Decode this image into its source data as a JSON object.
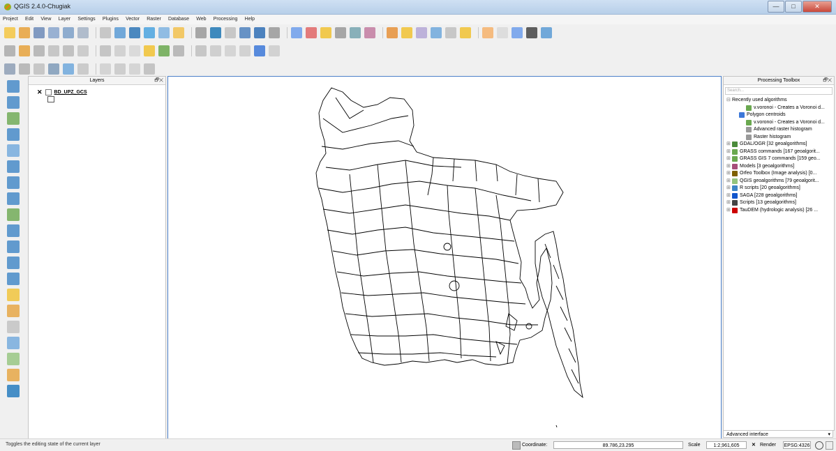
{
  "window": {
    "title": "QGIS 2.4.0-Chugiak",
    "controls": [
      "—",
      "□",
      "✕"
    ]
  },
  "menu": [
    "Project",
    "Edit",
    "View",
    "Layer",
    "Settings",
    "Plugins",
    "Vector",
    "Raster",
    "Database",
    "Web",
    "Processing",
    "Help"
  ],
  "layers_panel": {
    "title": "Layers",
    "controls": "🗗✕",
    "layer_name": "BD_UPZ_GCS"
  },
  "processing": {
    "title": "Processing Toolbox",
    "controls": "🗗✕",
    "search_placeholder": "Search...",
    "items": [
      {
        "label": "Recently used algorithms",
        "indent": 0,
        "pm": "⊟",
        "icon": "",
        "color": ""
      },
      {
        "label": "v.voronoi - Creates a Voronoi d...",
        "indent": 2,
        "pm": "",
        "icon": "grass-icon",
        "color": "#6aa84f"
      },
      {
        "label": "Polygon centroids",
        "indent": 1,
        "pm": "",
        "icon": "qgis-gear-icon",
        "color": "#3c78d8"
      },
      {
        "label": "v.voronoi - Creates a Voronoi d...",
        "indent": 2,
        "pm": "",
        "icon": "grass-icon",
        "color": "#6aa84f"
      },
      {
        "label": "Advanced raster histogram",
        "indent": 2,
        "pm": "",
        "icon": "gdal-icon",
        "color": "#999999"
      },
      {
        "label": "Raster histogram",
        "indent": 2,
        "pm": "",
        "icon": "gdal-icon",
        "color": "#999999"
      },
      {
        "label": "GDAL/OGR [32 geoalgorithms]",
        "indent": 0,
        "pm": "⊞",
        "icon": "gdal-icon",
        "color": "#4b8b3b"
      },
      {
        "label": "GRASS commands [167 geoalgorit...",
        "indent": 0,
        "pm": "⊞",
        "icon": "grass-icon",
        "color": "#6aa84f"
      },
      {
        "label": "GRASS GIS 7 commands [159 geo...",
        "indent": 0,
        "pm": "⊞",
        "icon": "grass-icon",
        "color": "#6aa84f"
      },
      {
        "label": "Models [3 geoalgorithms]",
        "indent": 0,
        "pm": "⊞",
        "icon": "model-icon",
        "color": "#a64d79"
      },
      {
        "label": "Orfeo Toolbox (Image analysis) [0...",
        "indent": 0,
        "pm": "⊞",
        "icon": "otb-icon",
        "color": "#7f6000"
      },
      {
        "label": "QGIS geoalgorithms [79 geoalgorit...",
        "indent": 0,
        "pm": "⊞",
        "icon": "qgis-icon",
        "color": "#93c47d"
      },
      {
        "label": "R scripts [20 geoalgorithms]",
        "indent": 0,
        "pm": "⊞",
        "icon": "r-icon",
        "color": "#3d85c6"
      },
      {
        "label": "SAGA [228 geoalgorithms]",
        "indent": 0,
        "pm": "⊞",
        "icon": "saga-icon",
        "color": "#1155cc"
      },
      {
        "label": "Scripts [13 geoalgorithms]",
        "indent": 0,
        "pm": "⊞",
        "icon": "script-icon",
        "color": "#444444"
      },
      {
        "label": "TauDEM (hydrologic analysis) [26 ...",
        "indent": 0,
        "pm": "⊞",
        "icon": "taudem-icon",
        "color": "#cc0000"
      }
    ],
    "advanced_interface": "Advanced interface"
  },
  "statusbar": {
    "message": "Toggles the editing state of the current layer",
    "coordinate_label": "Coordinate:",
    "coordinate_value": "89.786,23.295",
    "scale_label": "Scale",
    "scale_value": "1:2,961,605",
    "render_label": "Render",
    "crs": "EPSG:4326"
  },
  "toolbar_row1": [
    "#f4c542",
    "#e8a13a",
    "#6d8bb8",
    "#8aa6cc",
    "#7ca0c8",
    "#a4b3c6",
    "#c0c0c0",
    "#5a9bd5",
    "#2e75b6",
    "#4aa3df",
    "#7fb3e0",
    "#f2c14e",
    "#999999",
    "#1f77b4",
    "#c0c0c0",
    "#4f81bd",
    "#2f6fb5",
    "#999999",
    "#6d9eeb",
    "#e06666",
    "#f1c232",
    "#999999",
    "#76a5af",
    "#c27ba0",
    "#e69138",
    "#f1c232",
    "#b4a7d6",
    "#6fa8dc",
    "#c0c0c0",
    "#f1c232",
    "#f6b26b",
    "#d9d9d9",
    "#6d9eeb",
    "#444444",
    "#5b9bd5"
  ],
  "toolbar_row2": [
    "#aaaaaa",
    "#e6a23c",
    "#b0b0b0",
    "#c0c0c0",
    "#b8b8b8",
    "#c6c6c6",
    "#bdbdbd",
    "#cccccc",
    "#d6d6d6",
    "#f1c232",
    "#6aa84f",
    "#b0b0b0",
    "#c0c0c0",
    "#c9c9c9",
    "#d0d0d0",
    "#cccccc",
    "#3c78d8",
    "#cccccc"
  ],
  "toolbar_row3": [
    "#8e9fb5",
    "#b0b0b0",
    "#c0c0c0",
    "#7f9bb8",
    "#6fa8dc",
    "#c4c4c4",
    "#cfcfcf",
    "#c8c8c8",
    "#d0d0d0",
    "#bcbcbc"
  ],
  "left_tools": [
    "#3d85c6",
    "#3d85c6",
    "#6aa84f",
    "#3d85c6",
    "#6fa8dc",
    "#3d85c6",
    "#3d85c6",
    "#3d85c6",
    "#6aa84f",
    "#3d85c6",
    "#3d85c6",
    "#3d85c6",
    "#3d85c6",
    "#f1c232",
    "#e6a23c",
    "#c0c0c0",
    "#6fa8dc",
    "#93c47d",
    "#e6a23c",
    "#1c75bc"
  ]
}
